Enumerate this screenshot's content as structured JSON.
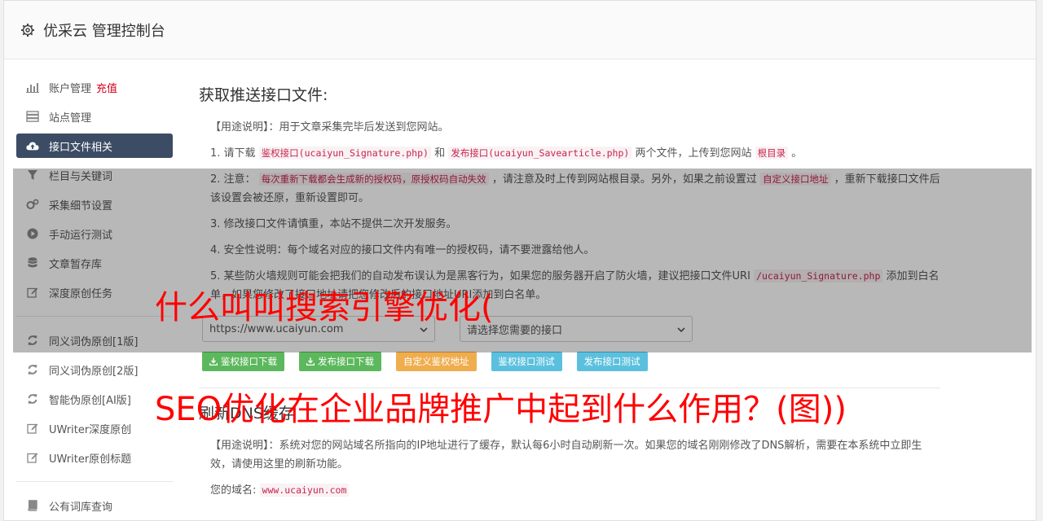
{
  "header": {
    "title": "优采云 管理控制台"
  },
  "sidebar": {
    "items": [
      {
        "label": "账户管理",
        "extra": "充值",
        "icon": "bar-chart-icon"
      },
      {
        "label": "站点管理",
        "icon": "server-icon"
      },
      {
        "label": "接口文件相关",
        "icon": "cloud-upload-icon",
        "active": true
      },
      {
        "label": "栏目与关键词",
        "icon": "filter-icon"
      },
      {
        "label": "采集细节设置",
        "icon": "cogs-icon"
      },
      {
        "label": "手动运行测试",
        "icon": "play-circle-icon"
      },
      {
        "label": "文章暂存库",
        "icon": "database-icon"
      },
      {
        "label": "深度原创任务",
        "icon": "edit-icon"
      },
      {
        "label": "同义词伪原创[1版]",
        "icon": "refresh-icon"
      },
      {
        "label": "同义词伪原创[2版]",
        "icon": "refresh-icon"
      },
      {
        "label": "智能伪原创[AI版]",
        "icon": "refresh-icon"
      },
      {
        "label": "UWriter深度原创",
        "icon": "edit-icon"
      },
      {
        "label": "UWriter原创标题",
        "icon": "edit-icon"
      },
      {
        "label": "公有词库查询",
        "icon": "book-icon"
      }
    ]
  },
  "main": {
    "section1": {
      "title": "获取推送接口文件:",
      "usage": "【用途说明】：用于文章采集完毕后发送到您网站。",
      "l1_a": "1. 请下载",
      "l1_code1": "鉴权接口(ucaiyun_Signature.php)",
      "l1_b": "和",
      "l1_code2": "发布接口(ucaiyun_Savearticle.php)",
      "l1_c": "两个文件，上传到您网站",
      "l1_code3": "根目录",
      "l1_d": "。",
      "l2_a": "2. 注意：",
      "l2_code1": "每次重新下载都会生成新的授权码，原授权码自动失效",
      "l2_b": "，请注意及时上传到网站根目录。另外，如果之前设置过",
      "l2_code2": "自定义接口地址",
      "l2_c": "，重新下载接口文件后该设置会被还原，重新设置即可。",
      "l3": "3. 修改接口文件请慎重，本站不提供二次开发服务。",
      "l4": "4. 安全性说明：每个域名对应的接口文件内有唯一的授权码，请不要泄露给他人。",
      "l5_a": "5. 某些防火墙规则可能会把我们的自动发布误认为是黑客行为，如果您的服务器开启了防火墙，建议把接口文件URI",
      "l5_code": "/ucaiyun_Signature.php",
      "l5_b": "添加到白名单，如果您修改了接口地址请把您修改后的接口地址URI添加到白名单。",
      "select_site": "https://www.ucaiyun.com",
      "select_interface": "请选择您需要的接口",
      "buttons": {
        "dl_auth": "鉴权接口下载",
        "dl_publish": "发布接口下载",
        "custom_auth": "自定义鉴权地址",
        "test_auth": "鉴权接口测试",
        "test_publish": "发布接口测试"
      }
    },
    "section2": {
      "title": "刷新DNS缓存",
      "usage": "【用途说明】：系统对您的网站域名所指向的IP地址进行了缓存，默认每6小时自动刷新一次。如果您的域名刚刚修改了DNS解析，需要在本系统中立即生效，请使用这里的刷新功能。",
      "domain_label": "您的域名:",
      "domain_value": "www.ucaiyun.com"
    }
  },
  "overlay_text": {
    "line1": "什么叫叫搜索引擎优化(",
    "line2": "SEO优化在企业品牌推广中起到什么作用？(图))"
  }
}
